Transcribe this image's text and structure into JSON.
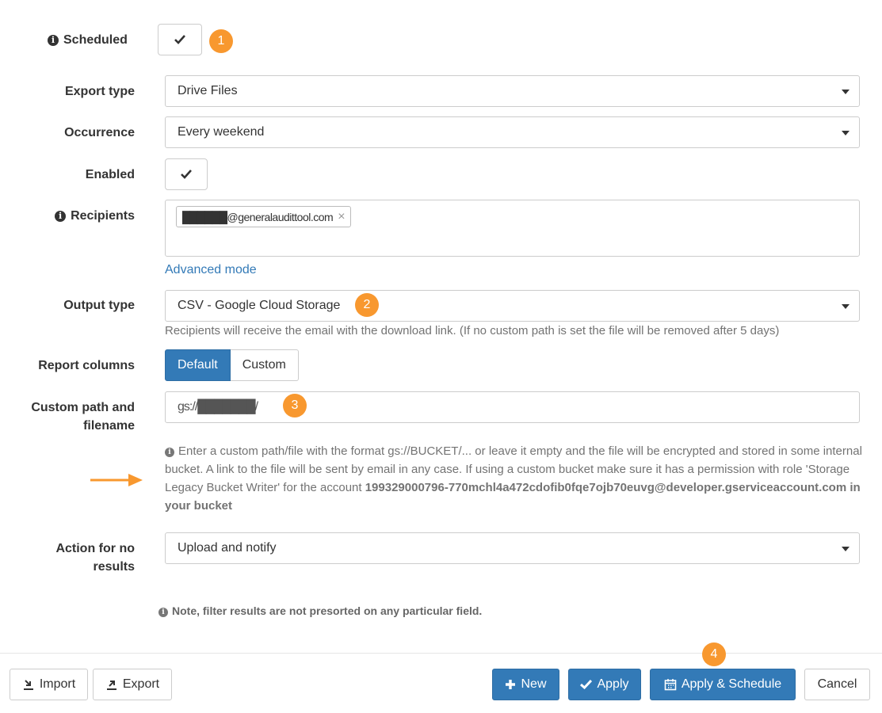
{
  "scheduled": {
    "label": "Scheduled",
    "checked": true,
    "badge": "1"
  },
  "export_type": {
    "label": "Export type",
    "value": "Drive Files"
  },
  "occurrence": {
    "label": "Occurrence",
    "value": "Every weekend"
  },
  "enabled": {
    "label": "Enabled",
    "checked": true
  },
  "recipients": {
    "label": "Recipients",
    "tags": [
      {
        "text": "██████@generalaudittool.com",
        "remove": "×"
      }
    ],
    "advanced_link": "Advanced mode"
  },
  "output_type": {
    "label": "Output type",
    "value": "CSV - Google Cloud Storage",
    "badge": "2",
    "help": "Recipients will receive the email with the download link. (If no custom path is set the file will be removed after 5 days)"
  },
  "report_columns": {
    "label": "Report columns",
    "options": [
      "Default",
      "Custom"
    ],
    "selected": "Default"
  },
  "custom_path": {
    "label_line1": "Custom path and",
    "label_line2": "filename",
    "value": "gs://███████/",
    "badge": "3",
    "help_text": "Enter a custom path/file with the format gs://BUCKET/... or leave it empty and the file will be encrypted and stored in some internal bucket. A link to the file will be sent by email in any case. If using a custom bucket make sure it has a permission with role 'Storage Legacy Bucket Writer' for the account",
    "help_account": "199329000796-770mchl4a472cdofib0fqe7ojb70euvg@developer.gserviceaccount.com in your bucket"
  },
  "no_results_action": {
    "label_line1": "Action for no",
    "label_line2": "results",
    "value": "Upload and notify"
  },
  "note": "Note, filter results are not presorted on any particular field.",
  "footer": {
    "import_label": "Import",
    "export_label": "Export",
    "new_label": "New",
    "apply_label": "Apply",
    "apply_schedule_label": "Apply & Schedule",
    "apply_schedule_badge": "4",
    "cancel_label": "Cancel"
  },
  "colors": {
    "primary": "#337ab7",
    "badge": "#f8982f",
    "link": "#337ab7",
    "arrow": "#f8982f"
  }
}
